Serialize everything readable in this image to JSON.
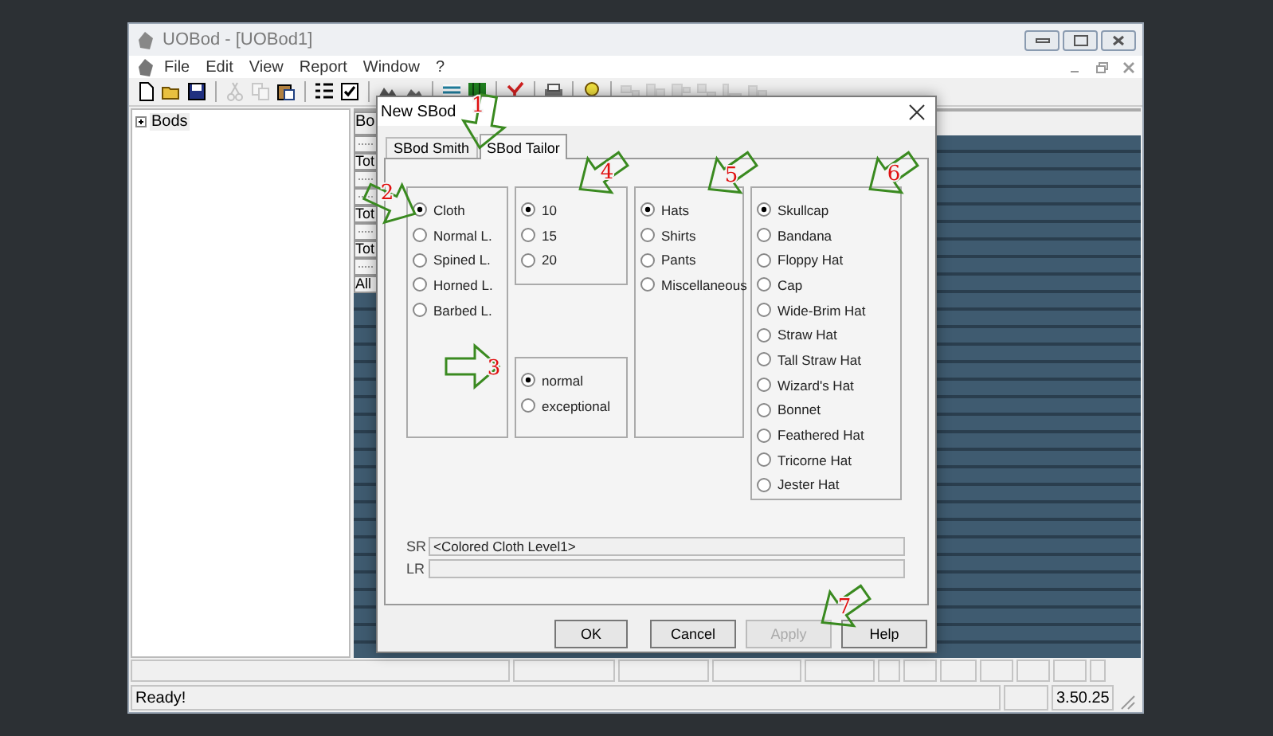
{
  "app_window": {
    "title": "UOBod - [UOBod1]"
  },
  "menu": [
    "File",
    "Edit",
    "View",
    "Report",
    "Window",
    "?"
  ],
  "toolbar": [
    {
      "kind": "button",
      "disabled": false
    },
    {
      "kind": "button",
      "disabled": false
    },
    {
      "kind": "button",
      "disabled": false
    },
    {
      "kind": "separator"
    },
    {
      "kind": "button",
      "disabled": true
    },
    {
      "kind": "button",
      "disabled": true
    },
    {
      "kind": "button",
      "disabled": false
    },
    {
      "kind": "separator"
    },
    {
      "kind": "button",
      "disabled": false
    },
    {
      "kind": "button",
      "disabled": false
    },
    {
      "kind": "separator"
    },
    {
      "kind": "button",
      "disabled": false
    },
    {
      "kind": "button",
      "disabled": false
    },
    {
      "kind": "separator"
    },
    {
      "kind": "button",
      "disabled": false
    },
    {
      "kind": "button",
      "disabled": false
    },
    {
      "kind": "separator"
    },
    {
      "kind": "button",
      "disabled": false
    },
    {
      "kind": "separator"
    },
    {
      "kind": "button",
      "disabled": false
    },
    {
      "kind": "separator"
    },
    {
      "kind": "button",
      "disabled": false
    },
    {
      "kind": "separator"
    },
    {
      "kind": "button",
      "disabled": true
    },
    {
      "kind": "button",
      "disabled": true
    },
    {
      "kind": "button",
      "disabled": true
    },
    {
      "kind": "button",
      "disabled": true
    },
    {
      "kind": "button",
      "disabled": true
    },
    {
      "kind": "button",
      "disabled": true
    }
  ],
  "tree": {
    "items": [
      {
        "label": "Bods",
        "expanded": false
      }
    ]
  },
  "document": {
    "header": "Bo",
    "cells": [
      {
        "kind": "mark"
      },
      {
        "kind": "text",
        "text": "Tot"
      },
      {
        "kind": "mark"
      },
      {
        "kind": "mark"
      },
      {
        "kind": "text",
        "text": "Tot"
      },
      {
        "kind": "mark"
      },
      {
        "kind": "text",
        "text": "Tot"
      },
      {
        "kind": "mark"
      },
      {
        "kind": "text",
        "text": "All"
      }
    ]
  },
  "dialog": {
    "title": "New SBod",
    "tabs": [
      {
        "label": "SBod Smith",
        "selected": false
      },
      {
        "label": "SBod Tailor",
        "selected": true
      }
    ],
    "material": [
      {
        "label": "Cloth",
        "selected": true
      },
      {
        "label": "Normal L.",
        "selected": false
      },
      {
        "label": "Spined L.",
        "selected": false
      },
      {
        "label": "Horned L.",
        "selected": false
      },
      {
        "label": "Barbed L.",
        "selected": false
      }
    ],
    "amount": [
      {
        "label": "10",
        "selected": true
      },
      {
        "label": "15",
        "selected": false
      },
      {
        "label": "20",
        "selected": false
      }
    ],
    "quality": [
      {
        "label": "normal",
        "selected": true
      },
      {
        "label": "exceptional",
        "selected": false
      }
    ],
    "category": [
      {
        "label": "Hats",
        "selected": true
      },
      {
        "label": "Shirts",
        "selected": false
      },
      {
        "label": "Pants",
        "selected": false
      },
      {
        "label": "Miscellaneous",
        "selected": false
      }
    ],
    "items": [
      {
        "label": "Skullcap",
        "selected": true
      },
      {
        "label": "Bandana",
        "selected": false
      },
      {
        "label": "Floppy Hat",
        "selected": false
      },
      {
        "label": "Cap",
        "selected": false
      },
      {
        "label": "Wide-Brim Hat",
        "selected": false
      },
      {
        "label": "Straw Hat",
        "selected": false
      },
      {
        "label": "Tall Straw Hat",
        "selected": false
      },
      {
        "label": "Wizard's Hat",
        "selected": false
      },
      {
        "label": "Bonnet",
        "selected": false
      },
      {
        "label": "Feathered Hat",
        "selected": false
      },
      {
        "label": "Tricorne Hat",
        "selected": false
      },
      {
        "label": "Jester Hat",
        "selected": false
      }
    ],
    "fields": [
      {
        "label": "SR",
        "value": "<Colored Cloth Level1>"
      },
      {
        "label": "LR"
      }
    ],
    "buttons": [
      {
        "label": "OK",
        "disabled": false
      },
      {
        "label": "Cancel",
        "disabled": false
      },
      {
        "label": "Apply",
        "disabled": true
      },
      {
        "label": "Help",
        "disabled": false
      }
    ]
  },
  "annotations": [
    {
      "label": "1"
    },
    {
      "label": "2"
    },
    {
      "label": "3"
    },
    {
      "label": "4"
    },
    {
      "label": "5"
    },
    {
      "label": "6"
    },
    {
      "label": "7"
    }
  ],
  "status_bar": {
    "message": "Ready!",
    "version": "3.50.25"
  }
}
